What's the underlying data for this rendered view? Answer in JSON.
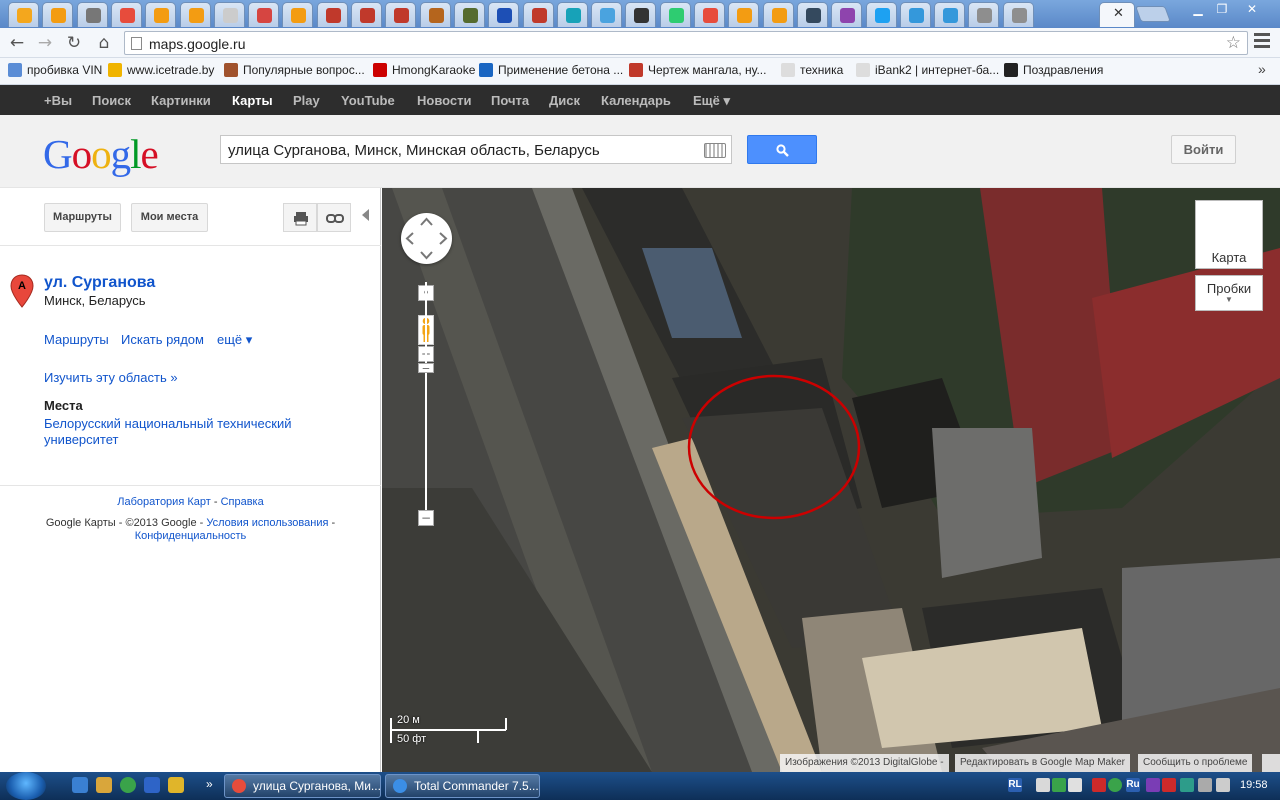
{
  "browser": {
    "tabs": [
      {
        "color": "#f4a71d"
      },
      {
        "color": "#f39c12"
      },
      {
        "color": "#777777"
      },
      {
        "color": "#e74c3c"
      },
      {
        "color": "#f39c12"
      },
      {
        "color": "#f39c12"
      },
      {
        "color": "#cccccc"
      },
      {
        "color": "#d64541"
      },
      {
        "color": "#f39c12"
      },
      {
        "color": "#c0392b"
      },
      {
        "color": "#c0392b"
      },
      {
        "color": "#c0392b"
      },
      {
        "color": "#b5651d"
      },
      {
        "color": "#556b2f"
      },
      {
        "color": "#1d4fb5"
      },
      {
        "color": "#c0392b"
      },
      {
        "color": "#17a2b8"
      },
      {
        "color": "#4aa3df"
      },
      {
        "color": "#333333"
      },
      {
        "color": "#2ecc71"
      },
      {
        "color": "#e74c3c"
      },
      {
        "color": "#f39c12"
      },
      {
        "color": "#f39c12"
      },
      {
        "color": "#34495e"
      },
      {
        "color": "#8e44ad"
      },
      {
        "color": "#1da1f2"
      },
      {
        "color": "#3498db"
      },
      {
        "color": "#3498db"
      },
      {
        "color": "#8e8e8e"
      },
      {
        "color": "#8e8e8e"
      }
    ],
    "active_tab_close": "✕",
    "url": "maps.google.ru",
    "bookmarks": [
      {
        "label": "пробивка VIN",
        "color": "#5b8dd6"
      },
      {
        "label": "www.icetrade.by",
        "color": "#f0b400"
      },
      {
        "label": "Популярные вопрос...",
        "color": "#a0522d"
      },
      {
        "label": "HmongKaraoke",
        "color": "#cc0000"
      },
      {
        "label": "Применение бетона ...",
        "color": "#1a66c2"
      },
      {
        "label": "Чертеж мангала, ну...",
        "color": "#c0392b"
      },
      {
        "label": "техника",
        "color": "#dddddd"
      },
      {
        "label": "iBank2 | интернет-ба...",
        "color": "#dddddd"
      },
      {
        "label": "Поздравления",
        "color": "#222222"
      }
    ],
    "bookmarks_more": "»"
  },
  "gbar": {
    "items": [
      "+Вы",
      "Поиск",
      "Картинки",
      "Карты",
      "Play",
      "YouTube",
      "Новости",
      "Почта",
      "Диск",
      "Календарь",
      "Ещё ▾"
    ],
    "active_index": 3
  },
  "header": {
    "logo_letters": [
      {
        "ch": "G",
        "color": "#3369e8"
      },
      {
        "ch": "o",
        "color": "#d50f25"
      },
      {
        "ch": "o",
        "color": "#eeb211"
      },
      {
        "ch": "g",
        "color": "#3369e8"
      },
      {
        "ch": "l",
        "color": "#009925"
      },
      {
        "ch": "e",
        "color": "#d50f25"
      }
    ],
    "search_value": "улица Сурганова, Минск, Минская область, Беларусь",
    "signin_label": "Войти"
  },
  "panel": {
    "routes_button": "Маршруты",
    "myplaces_button": "Мои места",
    "place_marker": "A",
    "place_name": "ул. Сурганова",
    "place_address": "Минск, Беларусь",
    "actions": [
      "Маршруты",
      "Искать рядом",
      "ещё ▾"
    ],
    "explore_link": "Изучить эту область »",
    "places_heading": "Места",
    "places_item_line1": "Белорусский национальный технический",
    "places_item_line2": "университет",
    "footer_lab": "Лаборатория Карт",
    "footer_sep": " - ",
    "footer_help": "Справка",
    "footer_copyright": "Google Карты - ©2013 Google - ",
    "footer_terms": "Условия использования",
    "footer_dash": " -",
    "footer_privacy": "Конфиденциальность"
  },
  "map": {
    "maptype_map": "Карта",
    "maptype_traffic": "Пробки",
    "scale_metric": "20 м",
    "scale_imperial": "50 фт",
    "attrib_imagery": "Изображения ©2013 DigitalGlobe -",
    "attrib_edit": "Редактировать в Google Map Maker",
    "attrib_report": "Сообщить о проблеме",
    "annotation_color": "#cc0000"
  },
  "taskbar": {
    "items": [
      {
        "label": "улица Сурганова, Ми...",
        "color": "#e74c3c"
      },
      {
        "label": "Total Commander 7.5...",
        "color": "#3b8ee6"
      }
    ],
    "lang": "RL",
    "lang2": "Ru",
    "time": "19:58"
  }
}
